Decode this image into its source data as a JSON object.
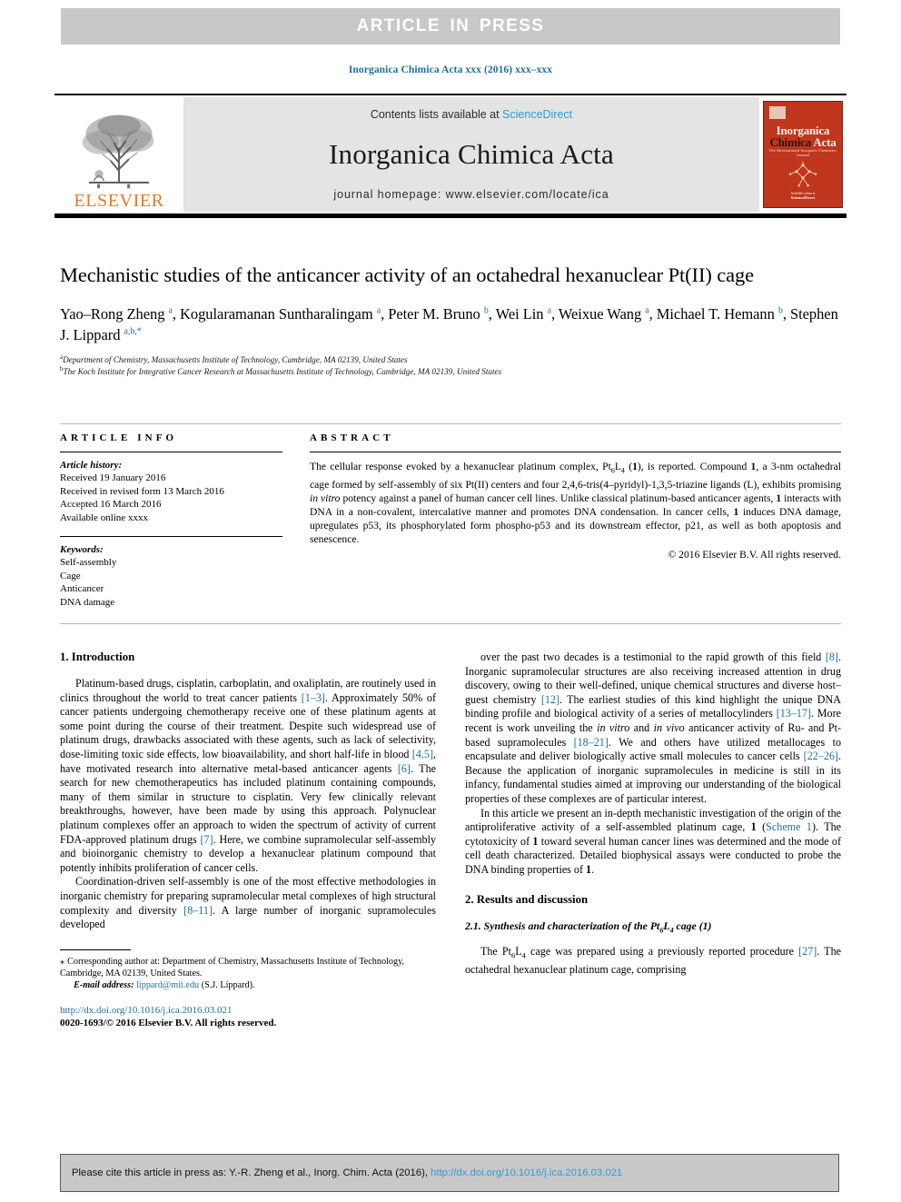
{
  "banner": {
    "text": "ARTICLE  IN  PRESS"
  },
  "running_head": "Inorganica Chimica Acta xxx (2016) xxx–xxx",
  "masthead": {
    "contents_prefix": "Contents lists available at ",
    "sciencedirect": "ScienceDirect",
    "journal_name": "Inorganica Chimica Acta",
    "homepage": "journal homepage: www.elsevier.com/locate/ica",
    "publisher": "ELSEVIER",
    "cover": {
      "line1": "Inorganica",
      "line2_a": "Chimica",
      "line2_b": "Acta",
      "subtitle": "The International Inorganic Chemistry Journal",
      "foot_small": "Available online at",
      "foot_big": "ScienceDirect"
    }
  },
  "article": {
    "title": "Mechanistic studies of the anticancer activity of an octahedral hexanuclear Pt(II) cage",
    "authors_html": "Yao–Rong Zheng <sup>a</sup>, Kogularamanan Suntharalingam <sup>a</sup>, Peter M. Bruno <sup>b</sup>, Wei Lin <sup>a</sup>, Weixue Wang <sup>a</sup>, Michael T. Hemann <sup>b</sup>, Stephen J. Lippard <sup>a,b,</sup><sup>*</sup>",
    "affiliation_a": "Department of Chemistry, Massachusetts Institute of Technology, Cambridge, MA 02139, United States",
    "affiliation_b": "The Koch Institute for Integrative Cancer Research at Massachusetts Institute of Technology, Cambridge, MA 02139, United States",
    "affil_a_marker": "a",
    "affil_b_marker": "b"
  },
  "article_info": {
    "heading": "ARTICLE INFO",
    "history_label": "Article history:",
    "history": [
      "Received 19 January 2016",
      "Received in revised form 13 March 2016",
      "Accepted 16 March 2016",
      "Available online xxxx"
    ],
    "keywords_label": "Keywords:",
    "keywords": [
      "Self-assembly",
      "Cage",
      "Anticancer",
      "DNA damage"
    ]
  },
  "abstract": {
    "heading": "ABSTRACT",
    "body_html": "The cellular response evoked by a hexanuclear platinum complex, Pt<sub>6</sub>L<sub>4</sub> (<b>1</b>), is reported. Compound <b>1</b>, a 3-nm octahedral cage formed by self-assembly of six Pt(II) centers and four 2,4,6-tris(4–pyridyl)-1,3,5-triazine ligands (L), exhibits promising <i>in vitro</i> potency against a panel of human cancer cell lines. Unlike classical platinum-based anticancer agents, <b>1</b> interacts with DNA in a non-covalent, intercalative manner and promotes DNA condensation. In cancer cells, <b>1</b> induces DNA damage, upregulates p53, its phosphorylated form phospho-p53 and its downstream effector, p21, as well as both apoptosis and senescence.",
    "copyright": "© 2016 Elsevier B.V. All rights reserved."
  },
  "sections": {
    "introduction_heading": "1. Introduction",
    "results_heading": "2. Results and discussion",
    "results_sub_html": "2.1. Synthesis and characterization of the Pt<sub>6</sub>L<sub>4</sub> cage (1)"
  },
  "body": {
    "left": [
      "Platinum-based drugs, cisplatin, carboplatin, and oxaliplatin, are routinely used in clinics throughout the world to treat cancer patients <span class=\"ref\">[1–3]</span>. Approximately 50% of cancer patients undergoing chemotherapy receive one of these platinum agents at some point during the course of their treatment. Despite such widespread use of platinum drugs, drawbacks associated with these agents, such as lack of selectivity, dose-limiting toxic side effects, low bioavailability, and short half-life in blood <span class=\"ref\">[4,5]</span>, have motivated research into alternative metal-based anticancer agents <span class=\"ref\">[6]</span>. The search for new chemotherapeutics has included platinum containing compounds, many of them similar in structure to cisplatin. Very few clinically relevant breakthroughs, however, have been made by using this approach. Polynuclear platinum complexes offer an approach to widen the spectrum of activity of current FDA-approved platinum drugs <span class=\"ref\">[7]</span>. Here, we combine supramolecular self-assembly and bioinorganic chemistry to develop a hexanuclear platinum compound that potently inhibits proliferation of cancer cells.",
      "Coordination-driven self-assembly is one of the most effective methodologies in inorganic chemistry for preparing supramolecular metal complexes of high structural complexity and diversity <span class=\"ref\">[8–11]</span>. A large number of inorganic supramolecules developed"
    ],
    "right": [
      "over the past two decades is a testimonial to the rapid growth of this field <span class=\"ref\">[8]</span>. Inorganic supramolecular structures are also receiving increased attention in drug discovery, owing to their well-defined, unique chemical structures and diverse host–guest chemistry <span class=\"ref\">[12]</span>. The earliest studies of this kind highlight the unique DNA binding profile and biological activity of a series of metallocylinders <span class=\"ref\">[13–17]</span>. More recent is work unveiling the <i>in vitro</i> and <i>in vivo</i> anticancer activity of Ru- and Pt-based supramolecules <span class=\"ref\">[18–21]</span>. We and others have utilized metallocages to encapsulate and deliver biologically active small molecules to cancer cells <span class=\"ref\">[22–26]</span>. Because the application of inorganic supramolecules in medicine is still in its infancy, fundamental studies aimed at improving our understanding of the biological properties of these complexes are of particular interest.",
      "In this article we present an in-depth mechanistic investigation of the origin of the antiproliferative activity of a self-assembled platinum cage, <b>1</b> (<span class=\"ref\">Scheme 1</span>). The cytotoxicity of <b>1</b> toward several human cancer lines was determined and the mode of cell death characterized. Detailed biophysical assays were conducted to probe the DNA binding properties of <b>1</b>.",
      "The Pt<sub>6</sub>L<sub>4</sub> cage was prepared using a previously reported procedure <span class=\"ref\">[27]</span>. The octahedral hexanuclear platinum cage, comprising"
    ]
  },
  "footnote": {
    "star": "⁎",
    "corresponding": "Corresponding author at: Department of Chemistry, Massachusetts Institute of Technology, Cambridge, MA 02139, United States.",
    "email_label": "E-mail address:",
    "email": "lippard@mit.edu",
    "email_owner": "(S.J. Lippard).",
    "doi": "http://dx.doi.org/10.1016/j.ica.2016.03.021",
    "issn_line": "0020-1693/© 2016 Elsevier B.V. All rights reserved."
  },
  "citation_footer": {
    "prefix": "Please cite this article in press as: Y.-R. Zheng et al., Inorg. Chim. Acta (2016), ",
    "link": "http://dx.doi.org/10.1016/j.ica.2016.03.021"
  },
  "colors": {
    "link": "#1a6fa3",
    "sciencedirect": "#2f9bd6",
    "elsevier_orange": "#E87722",
    "banner_gray": "#c8c8c8",
    "masthead_gray": "#e4e4e4",
    "cover_red": "#c0351d"
  }
}
